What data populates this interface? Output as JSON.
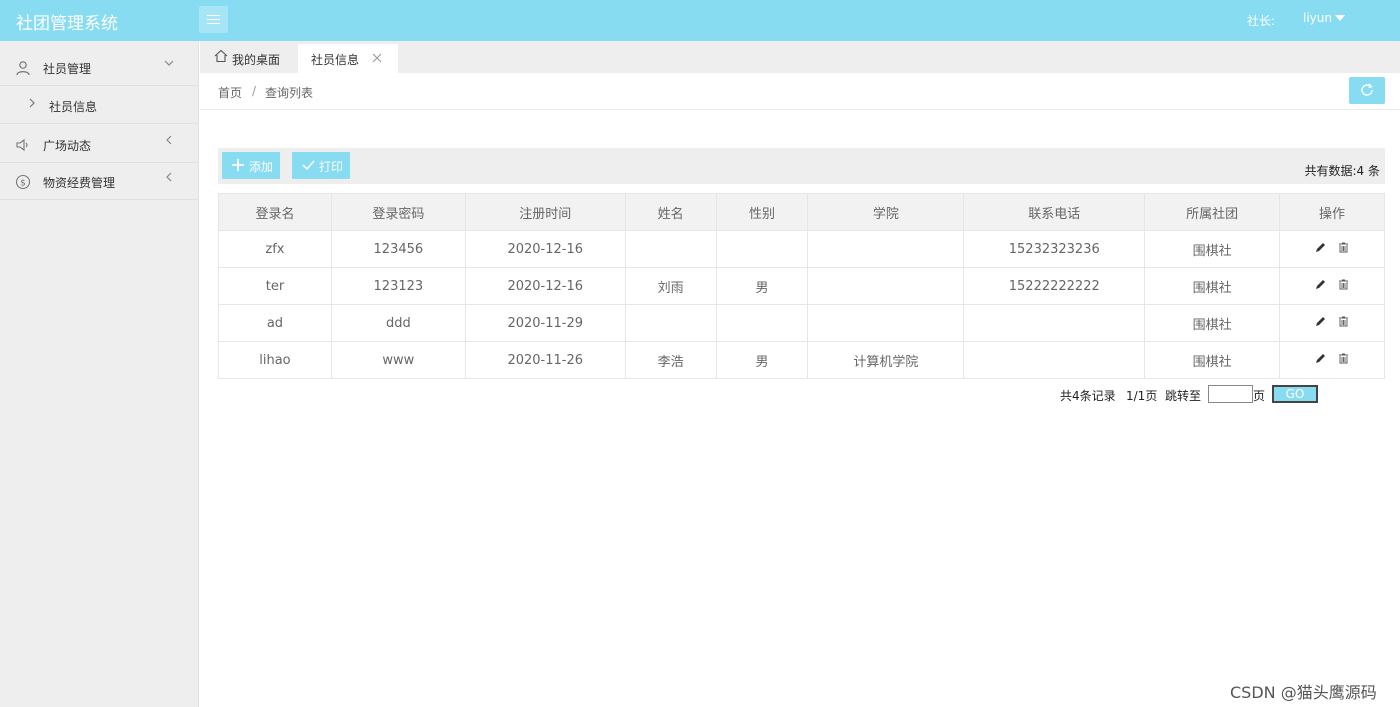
{
  "header": {
    "title": "社团管理系统",
    "user_role": "社长:",
    "user_name": "liyun"
  },
  "sidebar": {
    "items": [
      {
        "label": "社员管理",
        "icon": "user-icon",
        "sub": [
          {
            "label": "社员信息"
          }
        ]
      },
      {
        "label": "广场动态",
        "icon": "speaker-icon"
      },
      {
        "label": "物资经费管理",
        "icon": "dollar-icon"
      }
    ]
  },
  "tabs": [
    {
      "label": "我的桌面"
    },
    {
      "label": "社员信息"
    }
  ],
  "breadcrumb": [
    "首页",
    "/",
    "查询列表"
  ],
  "toolbar": {
    "add_label": "添加",
    "print_label": "打印",
    "total_label": "共有数据:4 条"
  },
  "table": {
    "headers": [
      "登录名",
      "登录密码",
      "注册时间",
      "姓名",
      "性别",
      "学院",
      "联系电话",
      "所属社团",
      "操作"
    ],
    "rows": [
      [
        "zfx",
        "123456",
        "2020-12-16",
        "",
        "",
        "",
        "15232323236",
        "围棋社"
      ],
      [
        "ter",
        "123123",
        "2020-12-16",
        "刘雨",
        "男",
        "",
        "15222222222",
        "围棋社"
      ],
      [
        "ad",
        "ddd",
        "2020-11-29",
        "",
        "",
        "",
        "",
        "围棋社"
      ],
      [
        "lihao",
        "www",
        "2020-11-26",
        "李浩",
        "男",
        "计算机学院",
        "",
        "围棋社"
      ]
    ]
  },
  "pager": {
    "records": "共4条记录",
    "pages": "1/1页",
    "jump": "跳转至",
    "page_unit": "页",
    "go_label": "GO"
  },
  "watermark": "CSDN @猫头鹰源码",
  "colors": {
    "accent": "#87dcf2",
    "sidebar_bg": "#eeeeee"
  }
}
